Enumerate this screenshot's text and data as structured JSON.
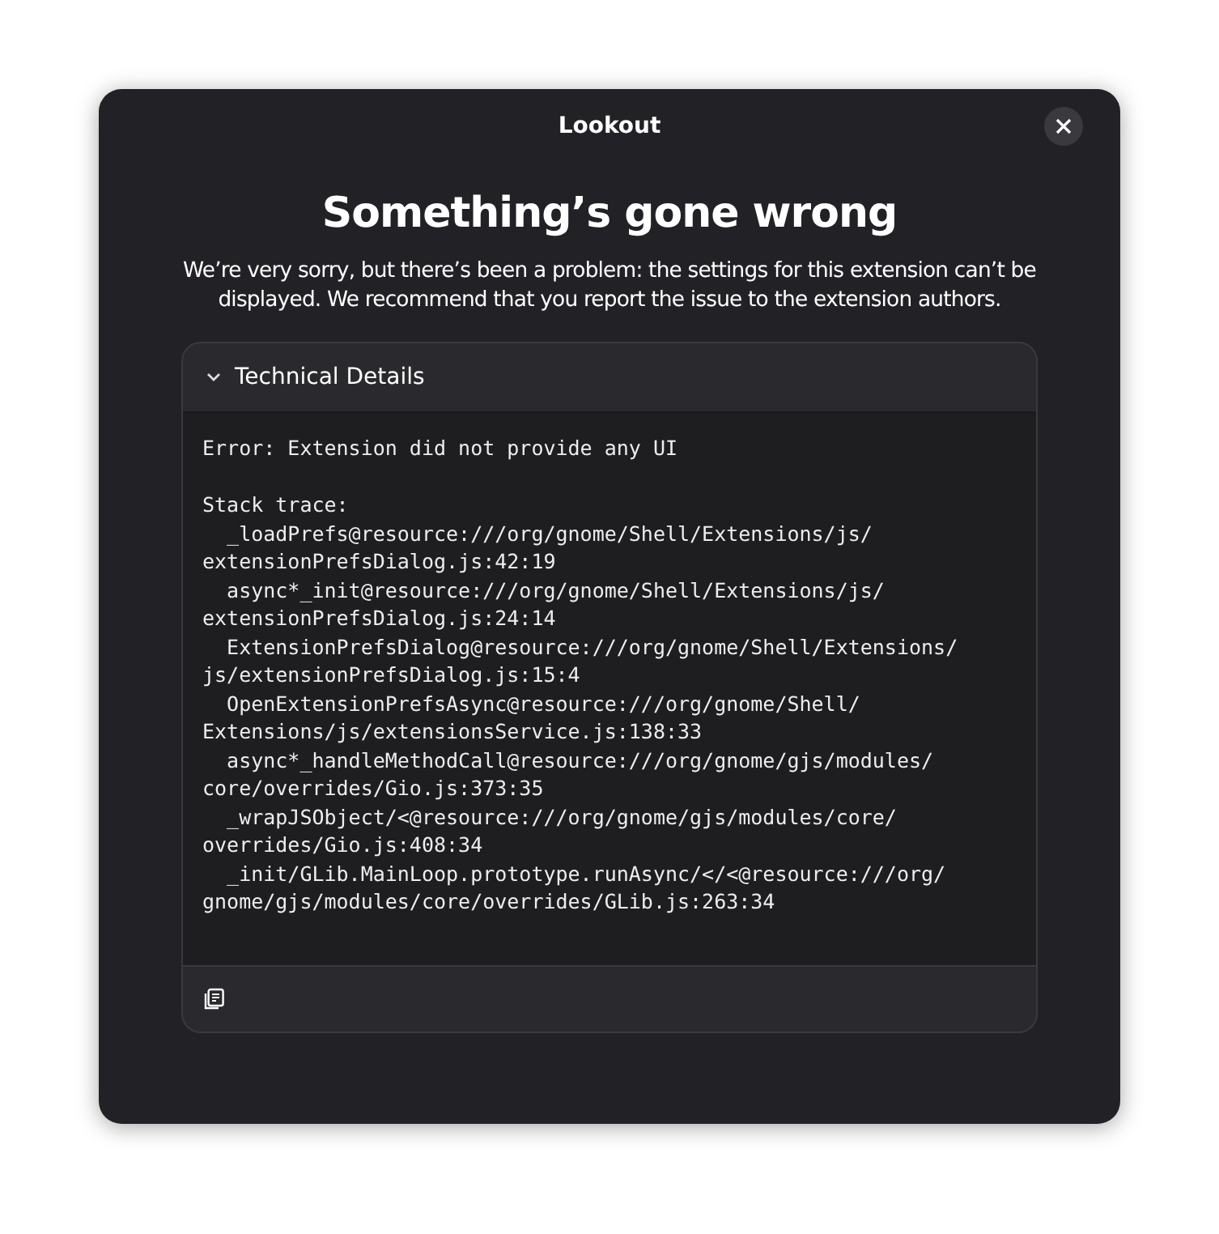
{
  "window": {
    "title": "Lookout"
  },
  "heading": "Something’s gone wrong",
  "message": "We’re very sorry, but there’s been a problem: the settings for this extension can’t be displayed. We recommend that you report the issue to the extension authors.",
  "details": {
    "label": "Technical Details",
    "expanded": true,
    "error": "Error: Extension did not provide any UI",
    "lines": [
      "Stack trace:",
      "  _loadPrefs@resource:///org/gnome/Shell/Extensions/js/",
      "extensionPrefsDialog.js:42:19",
      "  async*_init@resource:///org/gnome/Shell/Extensions/js/",
      "extensionPrefsDialog.js:24:14",
      "  ExtensionPrefsDialog@resource:///org/gnome/Shell/Extensions/",
      "js/extensionPrefsDialog.js:15:4",
      "  OpenExtensionPrefsAsync@resource:///org/gnome/Shell/",
      "Extensions/js/extensionsService.js:138:33",
      "  async*_handleMethodCall@resource:///org/gnome/gjs/modules/",
      "core/overrides/Gio.js:373:35",
      "  _wrapJSObject/<@resource:///org/gnome/gjs/modules/core/",
      "overrides/Gio.js:408:34",
      "  _init/GLib.MainLoop.prototype.runAsync/</<@resource:///org/",
      "gnome/gjs/modules/core/overrides/GLib.js:263:34"
    ]
  }
}
